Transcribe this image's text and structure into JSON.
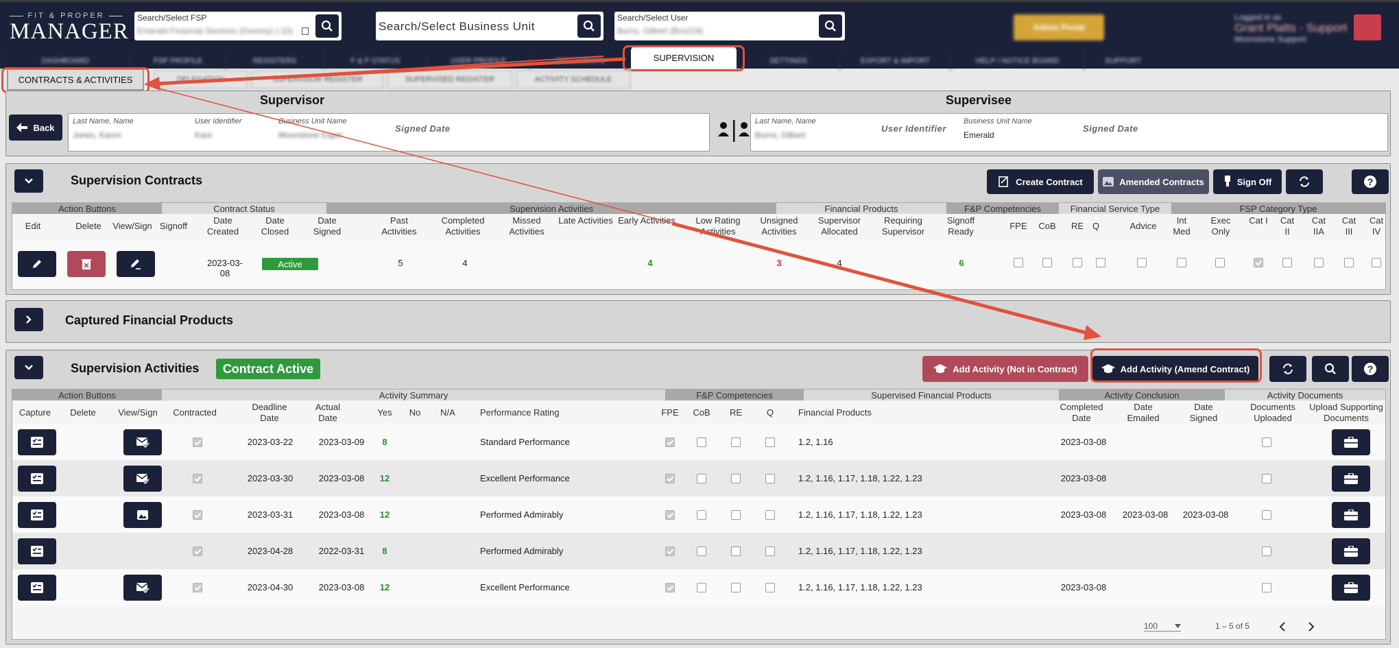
{
  "header": {
    "logo_small": "FIT & PROPER",
    "logo_big": "MANAGER",
    "fsp": {
      "label": "Search/Select FSP",
      "value": "Emerald Financial Services (Dummy) (-10)"
    },
    "bu": {
      "placeholder": "Search/Select Business Unit"
    },
    "user": {
      "label": "Search/Select User",
      "value": "Burns, Gilbert (Bns216)"
    },
    "admin_label": "Admin Portal",
    "user_logged": "Logged in as",
    "user_name": "Grant Platts - Support",
    "user_company": "Moonstone Support"
  },
  "nav": {
    "items": [
      "DASHBOARD",
      "FSP PROFILE",
      "REGISTERS",
      "F & P STATUS",
      "USER PROFILE",
      "DOCUMENTS",
      "SETTINGS",
      "EXPORT & IMPORT",
      "HELP / NOTICE BOARD",
      "SUPPORT"
    ],
    "active": "SUPERVISION"
  },
  "subtabs": {
    "active": "CONTRACTS & ACTIVITIES",
    "others": [
      "DELEGATION",
      "SUPERVISOR REGISTER",
      "SUPERVISED REGISTER",
      "ACTIVITY SCHEDULE"
    ]
  },
  "supervisor": {
    "title": "Supervisor",
    "back": "Back",
    "lbl_name": "Last Name, Name",
    "lbl_uid": "User Identifier",
    "lbl_bu": "Business Unit Name",
    "lbl_signed": "Signed Date",
    "name": "Jones, Karen",
    "uid": "Kare",
    "bu": "Moonstone Exper"
  },
  "supervisee": {
    "title": "Supervisee",
    "lbl_name": "Last Name, Name",
    "lbl_uid": "User Identifier",
    "lbl_bu": "Business Unit Name",
    "lbl_signed": "Signed Date",
    "name": "Burns, Gilbert",
    "bu": "Emerald"
  },
  "contracts": {
    "title": "Supervision Contracts",
    "btn_create": "Create Contract",
    "btn_amended": "Amended Contracts",
    "btn_signoff": "Sign Off",
    "groups": [
      "Action Buttons",
      "Contract Status",
      "Supervision Activities",
      "Financial Products",
      "F&P Competencies",
      "Financial Service Type",
      "FSP Category Type"
    ],
    "cols": {
      "edit": "Edit",
      "delete": "Delete",
      "view": "View/Sign",
      "signoff": "Signoff",
      "created": "Date Created",
      "closed": "Date Closed",
      "signed": "Date Signed",
      "past": "Past Activities",
      "completed": "Completed Activities",
      "missed": "Missed Activities",
      "late": "Late Activities",
      "early": "Early Activities",
      "lowrating": "Low Rating Activities",
      "unsigned": "Unsigned Activities",
      "supalloc": "Supervisor Allocated",
      "reqsup": "Requiring Supervisor",
      "signready": "Signoff Ready",
      "fpe": "FPE",
      "cob": "CoB",
      "re": "RE",
      "q": "Q",
      "advice": "Advice",
      "intmed": "Int Med",
      "exec": "Exec Only",
      "cat1": "Cat I",
      "cat2": "Cat II",
      "cat2a": "Cat IIA",
      "cat3": "Cat III",
      "cat4": "Cat IV"
    },
    "row": {
      "created": "2023-03-08",
      "status": "Active",
      "past": "5",
      "completed": "4",
      "early": "4",
      "unsigned": "3",
      "supalloc": "4",
      "signready": "6"
    }
  },
  "captured": {
    "title": "Captured Financial Products"
  },
  "activities": {
    "title": "Supervision Activities",
    "badge": "Contract Active",
    "btn_notin": "Add Activity (Not in Contract)",
    "btn_amend": "Add Activity (Amend Contract)",
    "groups": [
      "Action Buttons",
      "Activity Summary",
      "F&P Competencies",
      "Supervised Financial Products",
      "Activity Conclusion",
      "Activity Documents"
    ],
    "cols": {
      "capture": "Capture",
      "delete": "Delete",
      "view": "View/Sign",
      "contracted": "Contracted",
      "deadline": "Deadline Date",
      "actual": "Actual Date",
      "yes": "Yes",
      "no": "No",
      "na": "N/A",
      "rating": "Performance Rating",
      "fpe": "FPE",
      "cob": "CoB",
      "re": "RE",
      "q": "Q",
      "products": "Financial Products",
      "completed": "Completed Date",
      "emailed": "Date Emailed",
      "signed": "Date Signed",
      "uploaded": "Documents Uploaded",
      "upload": "Upload Supporting Documents"
    },
    "rows": [
      {
        "deadline": "2023-03-22",
        "actual": "2023-03-09",
        "yes": "8",
        "rating": "Standard Performance",
        "products": "1.2, 1.16",
        "completed": "2023-03-08",
        "emailed": "",
        "signed": "",
        "view": "mail"
      },
      {
        "deadline": "2023-03-30",
        "actual": "2023-03-08",
        "yes": "12",
        "rating": "Excellent Performance",
        "products": "1.2, 1.16, 1.17, 1.18, 1.22, 1.23",
        "completed": "2023-03-08",
        "emailed": "",
        "signed": "",
        "view": "mail"
      },
      {
        "deadline": "2023-03-31",
        "actual": "2023-03-08",
        "yes": "12",
        "rating": "Performed Admirably",
        "products": "1.2, 1.16, 1.17, 1.18, 1.22, 1.23",
        "completed": "2023-03-08",
        "emailed": "2023-03-08",
        "signed": "2023-03-08",
        "view": "image"
      },
      {
        "deadline": "2023-04-28",
        "actual": "2022-03-31",
        "yes": "8",
        "rating": "Performed Admirably",
        "products": "1.2, 1.16, 1.17, 1.18, 1.22, 1.23",
        "completed": "",
        "emailed": "",
        "signed": "",
        "view": ""
      },
      {
        "deadline": "2023-04-30",
        "actual": "2023-03-08",
        "yes": "12",
        "rating": "Excellent Performance",
        "products": "1.2, 1.16, 1.17, 1.18, 1.22, 1.23",
        "completed": "2023-03-08",
        "emailed": "",
        "signed": "",
        "view": "mail"
      }
    ],
    "pager": {
      "per_page": "100",
      "range": "1 – 5 of 5"
    }
  }
}
